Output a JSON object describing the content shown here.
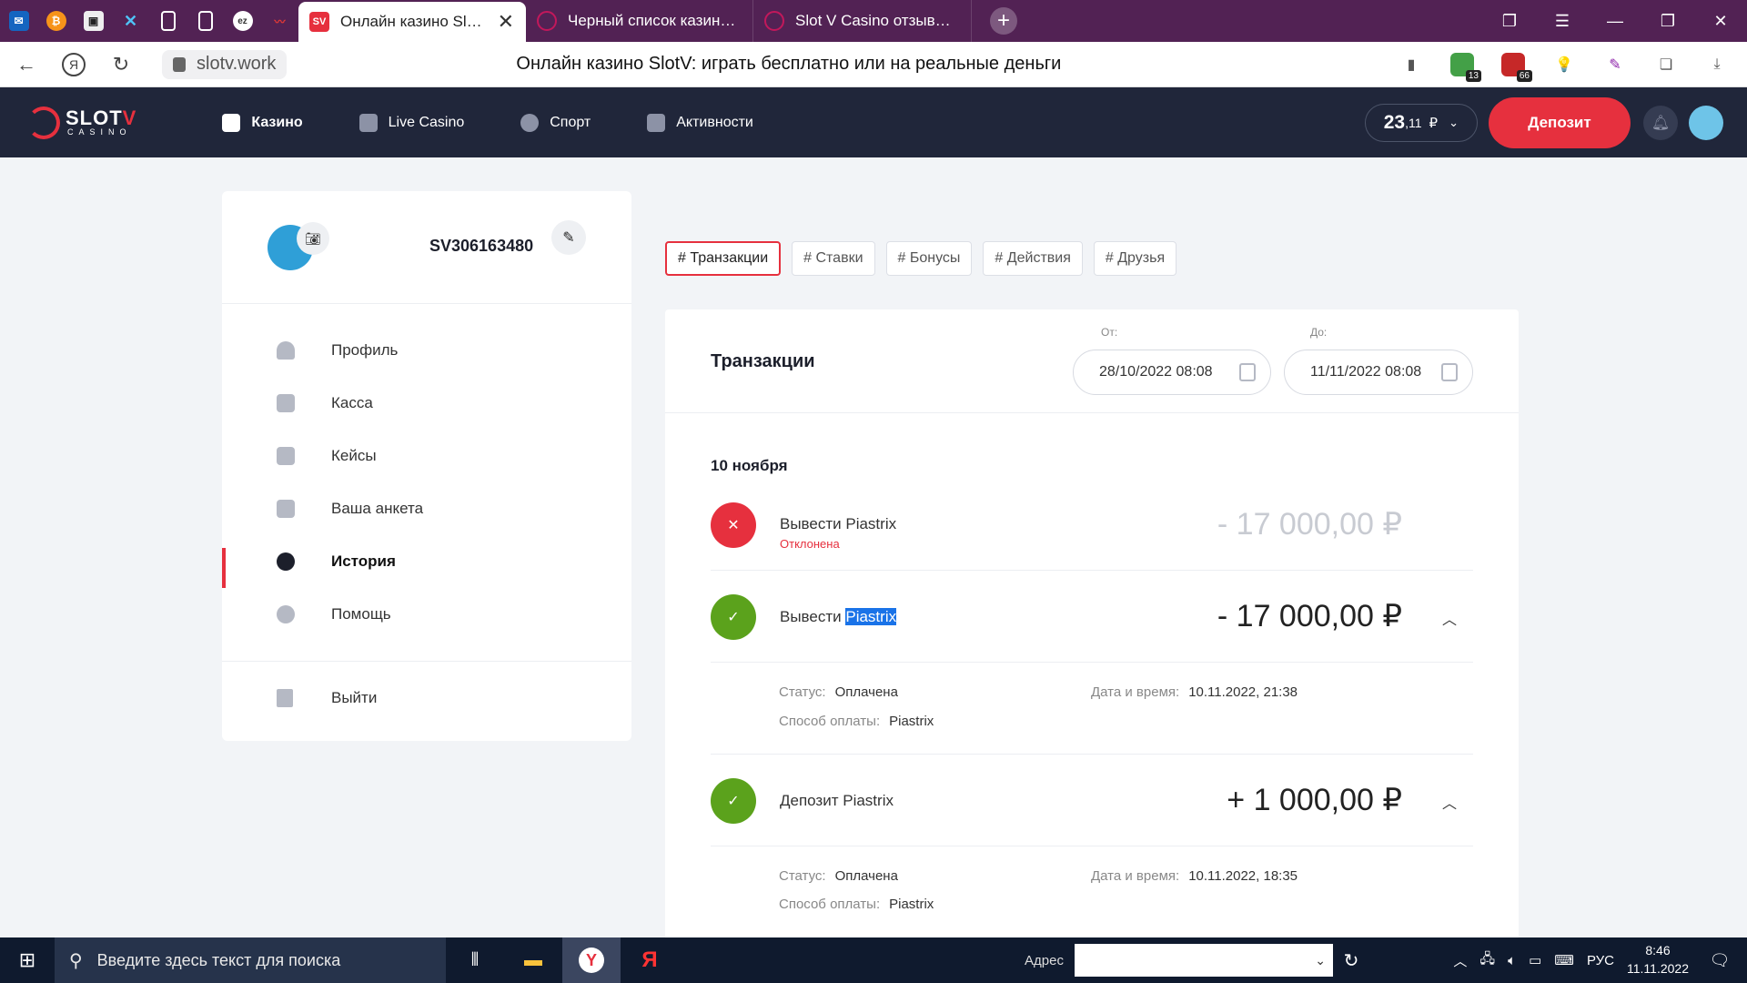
{
  "browser": {
    "tabs": [
      {
        "title": "Онлайн казино SlotV: играть",
        "close": "✕"
      },
      {
        "title": "Черный список казино онлайн"
      },
      {
        "title": "Slot V Casino отзывы реальные"
      }
    ],
    "new_tab": "+",
    "url": "slotv.work",
    "page_title": "Онлайн казино SlotV: играть бесплатно или на реальные деньги",
    "ext_badges": [
      "13",
      "66"
    ]
  },
  "site": {
    "logo_main": "SLOT",
    "logo_accent": "V",
    "logo_sub": "CASINO",
    "nav": [
      {
        "label": "Казино",
        "icon": "casino-icon"
      },
      {
        "label": "Live Casino",
        "icon": "live-dealer-icon"
      },
      {
        "label": "Спорт",
        "icon": "sport-ball-icon"
      },
      {
        "label": "Активности",
        "icon": "rocket-icon"
      }
    ],
    "balance_int": "23",
    "balance_dec": ",11",
    "currency": "₽",
    "deposit_label": "Депозит"
  },
  "sidebar": {
    "user_id": "SV306163480",
    "menu": [
      {
        "label": "Профиль",
        "icon": "user-icon"
      },
      {
        "label": "Касса",
        "icon": "wallet-icon"
      },
      {
        "label": "Кейсы",
        "icon": "box-icon"
      },
      {
        "label": "Ваша анкета",
        "icon": "bar-chart-icon"
      },
      {
        "label": "История",
        "icon": "history-gear-icon"
      },
      {
        "label": "Помощь",
        "icon": "lifebuoy-icon"
      }
    ],
    "logout_label": "Выйти"
  },
  "filters": [
    "# Транзакции",
    "# Ставки",
    "# Бонусы",
    "# Действия",
    "# Друзья"
  ],
  "transactions": {
    "title": "Транзакции",
    "from_label": "От:",
    "from_value": "28/10/2022 08:08",
    "to_label": "До:",
    "to_value": "11/11/2022 08:08",
    "group_date": "10 ноября",
    "items": [
      {
        "name": "Вывести Piastrix",
        "status_text": "Отклонена",
        "amount": "- 17 000,00  ₽",
        "state": "rejected"
      },
      {
        "name_prefix": "Вывести ",
        "name_highlight": "Piastrix",
        "amount": "- 17 000,00  ₽",
        "state": "paid",
        "status_label": "Статус:",
        "status": "Оплачена",
        "method_label": "Способ оплаты:",
        "method": "Piastrix",
        "datetime_label": "Дата и время:",
        "datetime": "10.11.2022, 21:38"
      },
      {
        "name": "Депозит Piastrix",
        "amount": "+ 1 000,00  ₽",
        "state": "paid",
        "status_label": "Статус:",
        "status": "Оплачена",
        "method_label": "Способ оплаты:",
        "method": "Piastrix",
        "datetime_label": "Дата и время:",
        "datetime": "10.11.2022, 18:35"
      }
    ]
  },
  "taskbar": {
    "search_placeholder": "Введите здесь текст для поиска",
    "address_label": "Адрес",
    "lang": "РУС",
    "time": "8:46",
    "date": "11.11.2022"
  },
  "colors": {
    "brand_red": "#e6303e",
    "header_bg": "#20263a",
    "success_green": "#5ba21c",
    "browser_tab_bg": "#522254"
  }
}
